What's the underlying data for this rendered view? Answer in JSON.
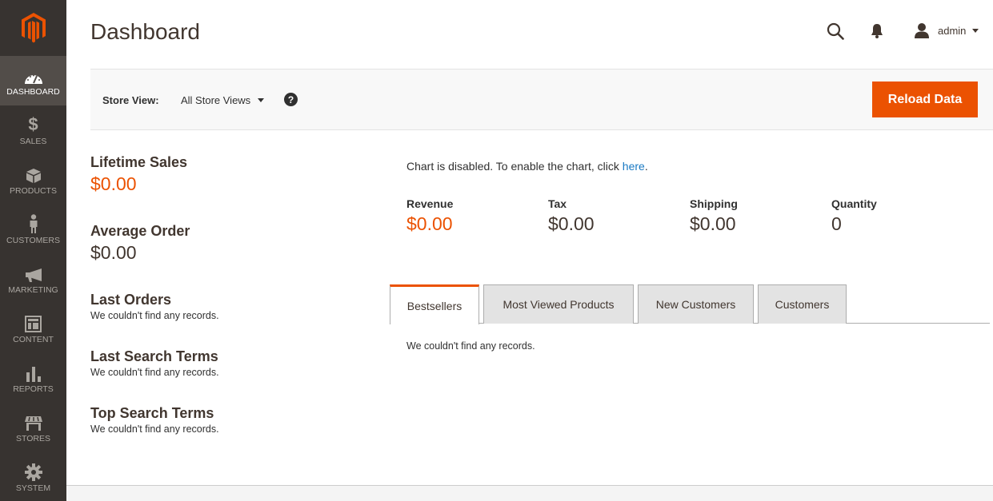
{
  "brand": {
    "accent": "#eb5202",
    "sidebar_bg": "#373330",
    "link": "#1979c3"
  },
  "sidebar": {
    "items": [
      {
        "label": "Dashboard",
        "icon": "dashboard-icon",
        "active": true
      },
      {
        "label": "Sales",
        "icon": "dollar-icon"
      },
      {
        "label": "Products",
        "icon": "box-icon"
      },
      {
        "label": "Customers",
        "icon": "person-icon"
      },
      {
        "label": "Marketing",
        "icon": "megaphone-icon"
      },
      {
        "label": "Content",
        "icon": "layout-icon"
      },
      {
        "label": "Reports",
        "icon": "bar-chart-icon"
      },
      {
        "label": "Stores",
        "icon": "storefront-icon"
      },
      {
        "label": "System",
        "icon": "gear-icon"
      }
    ]
  },
  "header": {
    "title": "Dashboard",
    "user": "admin"
  },
  "store_bar": {
    "label": "Store View:",
    "selected": "All Store Views",
    "help": "?",
    "reload_label": "Reload Data"
  },
  "left": {
    "lifetime_sales": {
      "title": "Lifetime Sales",
      "value": "$0.00"
    },
    "average_order": {
      "title": "Average Order",
      "value": "$0.00"
    },
    "sections": [
      {
        "title": "Last Orders",
        "empty": "We couldn't find any records."
      },
      {
        "title": "Last Search Terms",
        "empty": "We couldn't find any records."
      },
      {
        "title": "Top Search Terms",
        "empty": "We couldn't find any records."
      }
    ]
  },
  "chart": {
    "message": "Chart is disabled. To enable the chart, click ",
    "link": "here",
    "suffix": "."
  },
  "totals": [
    {
      "label": "Revenue",
      "value": "$0.00"
    },
    {
      "label": "Tax",
      "value": "$0.00"
    },
    {
      "label": "Shipping",
      "value": "$0.00"
    },
    {
      "label": "Quantity",
      "value": "0"
    }
  ],
  "tabs": [
    {
      "label": "Bestsellers",
      "active": true
    },
    {
      "label": "Most Viewed Products"
    },
    {
      "label": "New Customers"
    },
    {
      "label": "Customers"
    }
  ],
  "tab_content": {
    "empty": "We couldn't find any records."
  }
}
